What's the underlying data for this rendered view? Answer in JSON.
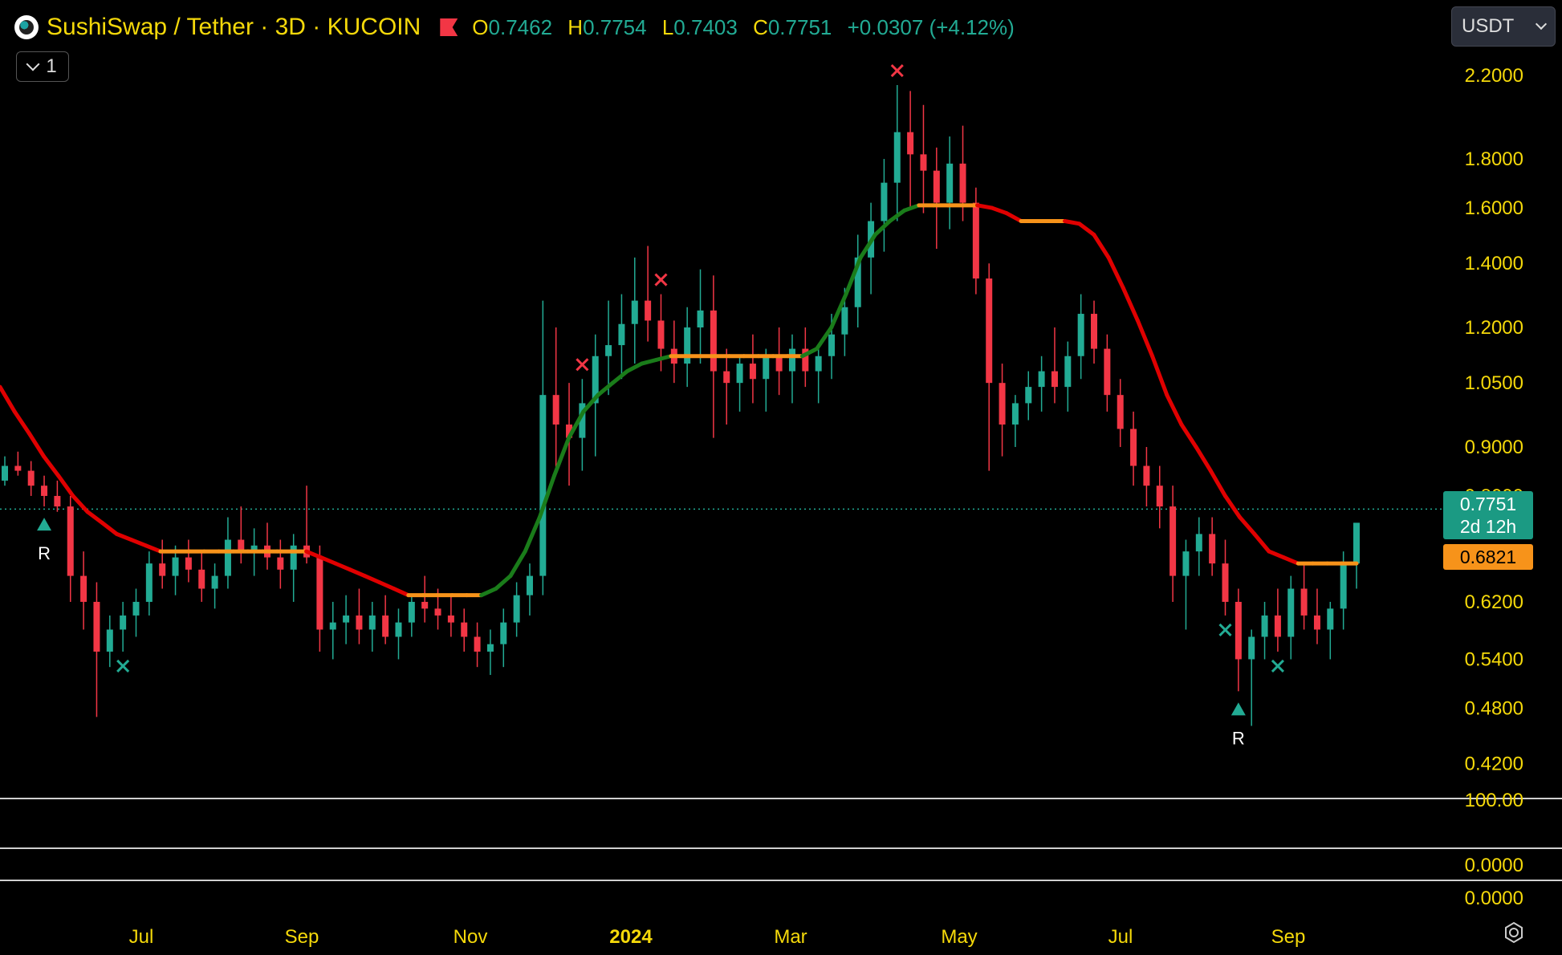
{
  "header": {
    "symbol": "SushiSwap / Tether · 3D · KUCOIN",
    "open_label": "O",
    "open": "0.7462",
    "high_label": "H",
    "high": "0.7754",
    "low_label": "L",
    "low": "0.7403",
    "close_label": "C",
    "close": "0.7751",
    "change": "+0.0307 (+4.12%)"
  },
  "indicator_toggle": {
    "count": "1"
  },
  "currency_select": {
    "value": "USDT"
  },
  "price_tags": {
    "last_price": "0.7751",
    "countdown": "2d 12h",
    "indicator_value": "0.6821"
  },
  "colors": {
    "up": "#22ab94",
    "down": "#f23645",
    "trend_up": "#1a7c1a",
    "trend_down": "#e00000",
    "trend_flat": "#f7931a",
    "axis_text": "#f5d90a"
  },
  "chart_data": {
    "type": "candlestick",
    "y_scale": "log",
    "ylim": [
      0.39,
      2.35
    ],
    "y_ticks": [
      "2.2000",
      "1.8000",
      "1.6000",
      "1.4000",
      "1.2000",
      "1.0500",
      "0.9000",
      "0.8000",
      "0.6200",
      "0.5400",
      "0.4800",
      "0.4200"
    ],
    "x_ticks": [
      "Jul",
      "Sep",
      "Nov",
      "2024",
      "Mar",
      "May",
      "Jul",
      "Sep"
    ],
    "lower_pane_labels": [
      "100.00",
      "0.0000",
      "0.0000"
    ],
    "candles": [
      [
        0.83,
        0.88,
        0.82,
        0.86
      ],
      [
        0.86,
        0.89,
        0.84,
        0.85
      ],
      [
        0.85,
        0.87,
        0.8,
        0.82
      ],
      [
        0.82,
        0.84,
        0.78,
        0.8
      ],
      [
        0.8,
        0.83,
        0.77,
        0.78
      ],
      [
        0.78,
        0.8,
        0.62,
        0.66
      ],
      [
        0.66,
        0.7,
        0.58,
        0.62
      ],
      [
        0.62,
        0.65,
        0.47,
        0.55
      ],
      [
        0.55,
        0.6,
        0.53,
        0.58
      ],
      [
        0.58,
        0.62,
        0.55,
        0.6
      ],
      [
        0.6,
        0.64,
        0.57,
        0.62
      ],
      [
        0.62,
        0.7,
        0.6,
        0.68
      ],
      [
        0.68,
        0.72,
        0.64,
        0.66
      ],
      [
        0.66,
        0.71,
        0.63,
        0.69
      ],
      [
        0.69,
        0.72,
        0.65,
        0.67
      ],
      [
        0.67,
        0.7,
        0.62,
        0.64
      ],
      [
        0.64,
        0.68,
        0.61,
        0.66
      ],
      [
        0.66,
        0.76,
        0.64,
        0.72
      ],
      [
        0.72,
        0.78,
        0.68,
        0.7
      ],
      [
        0.7,
        0.74,
        0.66,
        0.71
      ],
      [
        0.71,
        0.75,
        0.67,
        0.69
      ],
      [
        0.69,
        0.72,
        0.64,
        0.67
      ],
      [
        0.67,
        0.73,
        0.62,
        0.71
      ],
      [
        0.71,
        0.82,
        0.68,
        0.69
      ],
      [
        0.69,
        0.71,
        0.55,
        0.58
      ],
      [
        0.58,
        0.62,
        0.54,
        0.59
      ],
      [
        0.59,
        0.63,
        0.56,
        0.6
      ],
      [
        0.6,
        0.64,
        0.56,
        0.58
      ],
      [
        0.58,
        0.62,
        0.55,
        0.6
      ],
      [
        0.6,
        0.63,
        0.56,
        0.57
      ],
      [
        0.57,
        0.61,
        0.54,
        0.59
      ],
      [
        0.59,
        0.63,
        0.57,
        0.62
      ],
      [
        0.62,
        0.66,
        0.59,
        0.61
      ],
      [
        0.61,
        0.64,
        0.58,
        0.6
      ],
      [
        0.6,
        0.63,
        0.57,
        0.59
      ],
      [
        0.59,
        0.61,
        0.55,
        0.57
      ],
      [
        0.57,
        0.59,
        0.53,
        0.55
      ],
      [
        0.55,
        0.58,
        0.52,
        0.56
      ],
      [
        0.56,
        0.61,
        0.53,
        0.59
      ],
      [
        0.59,
        0.65,
        0.57,
        0.63
      ],
      [
        0.63,
        0.68,
        0.6,
        0.66
      ],
      [
        0.66,
        1.28,
        0.63,
        1.02
      ],
      [
        1.02,
        1.2,
        0.85,
        0.95
      ],
      [
        0.95,
        1.05,
        0.82,
        0.92
      ],
      [
        0.92,
        1.06,
        0.85,
        1.0
      ],
      [
        1.0,
        1.18,
        0.88,
        1.12
      ],
      [
        1.12,
        1.28,
        1.02,
        1.15
      ],
      [
        1.15,
        1.3,
        1.06,
        1.21
      ],
      [
        1.21,
        1.42,
        1.1,
        1.28
      ],
      [
        1.28,
        1.46,
        1.16,
        1.22
      ],
      [
        1.22,
        1.3,
        1.08,
        1.14
      ],
      [
        1.14,
        1.22,
        1.05,
        1.1
      ],
      [
        1.1,
        1.26,
        1.04,
        1.2
      ],
      [
        1.2,
        1.38,
        1.1,
        1.25
      ],
      [
        1.25,
        1.36,
        0.92,
        1.08
      ],
      [
        1.08,
        1.14,
        0.95,
        1.05
      ],
      [
        1.05,
        1.12,
        0.98,
        1.1
      ],
      [
        1.1,
        1.18,
        1.0,
        1.06
      ],
      [
        1.06,
        1.14,
        0.98,
        1.12
      ],
      [
        1.12,
        1.2,
        1.02,
        1.08
      ],
      [
        1.08,
        1.18,
        1.0,
        1.14
      ],
      [
        1.14,
        1.2,
        1.04,
        1.08
      ],
      [
        1.08,
        1.14,
        1.0,
        1.12
      ],
      [
        1.12,
        1.24,
        1.06,
        1.18
      ],
      [
        1.18,
        1.32,
        1.12,
        1.26
      ],
      [
        1.26,
        1.5,
        1.2,
        1.42
      ],
      [
        1.42,
        1.62,
        1.3,
        1.55
      ],
      [
        1.55,
        1.8,
        1.44,
        1.7
      ],
      [
        1.7,
        2.15,
        1.55,
        1.92
      ],
      [
        1.92,
        2.12,
        1.6,
        1.82
      ],
      [
        1.82,
        2.05,
        1.58,
        1.75
      ],
      [
        1.75,
        1.85,
        1.45,
        1.62
      ],
      [
        1.62,
        1.9,
        1.52,
        1.78
      ],
      [
        1.78,
        1.95,
        1.55,
        1.62
      ],
      [
        1.62,
        1.68,
        1.3,
        1.35
      ],
      [
        1.35,
        1.4,
        0.85,
        1.05
      ],
      [
        1.05,
        1.1,
        0.88,
        0.95
      ],
      [
        0.95,
        1.02,
        0.9,
        1.0
      ],
      [
        1.0,
        1.08,
        0.96,
        1.04
      ],
      [
        1.04,
        1.12,
        0.98,
        1.08
      ],
      [
        1.08,
        1.2,
        1.0,
        1.04
      ],
      [
        1.04,
        1.16,
        0.98,
        1.12
      ],
      [
        1.12,
        1.3,
        1.06,
        1.24
      ],
      [
        1.24,
        1.28,
        1.1,
        1.14
      ],
      [
        1.14,
        1.18,
        0.98,
        1.02
      ],
      [
        1.02,
        1.06,
        0.9,
        0.94
      ],
      [
        0.94,
        0.98,
        0.82,
        0.86
      ],
      [
        0.86,
        0.9,
        0.78,
        0.82
      ],
      [
        0.82,
        0.86,
        0.74,
        0.78
      ],
      [
        0.78,
        0.82,
        0.62,
        0.66
      ],
      [
        0.66,
        0.72,
        0.58,
        0.7
      ],
      [
        0.7,
        0.76,
        0.66,
        0.73
      ],
      [
        0.73,
        0.76,
        0.66,
        0.68
      ],
      [
        0.68,
        0.72,
        0.6,
        0.62
      ],
      [
        0.62,
        0.64,
        0.5,
        0.54
      ],
      [
        0.54,
        0.58,
        0.46,
        0.57
      ],
      [
        0.57,
        0.62,
        0.54,
        0.6
      ],
      [
        0.6,
        0.64,
        0.55,
        0.57
      ],
      [
        0.57,
        0.66,
        0.54,
        0.64
      ],
      [
        0.64,
        0.68,
        0.58,
        0.6
      ],
      [
        0.6,
        0.64,
        0.56,
        0.58
      ],
      [
        0.58,
        0.62,
        0.54,
        0.61
      ],
      [
        0.61,
        0.7,
        0.58,
        0.68
      ],
      [
        0.68,
        0.74,
        0.64,
        0.75
      ]
    ],
    "trend_line": [
      1.04,
      0.98,
      0.93,
      0.88,
      0.84,
      0.8,
      0.77,
      0.75,
      0.73,
      0.72,
      0.71,
      0.7,
      0.7,
      0.7,
      0.7,
      0.7,
      0.7,
      0.7,
      0.7,
      0.7,
      0.7,
      0.7,
      0.69,
      0.68,
      0.67,
      0.66,
      0.65,
      0.64,
      0.63,
      0.63,
      0.63,
      0.63,
      0.63,
      0.63,
      0.64,
      0.66,
      0.7,
      0.76,
      0.84,
      0.92,
      0.98,
      1.02,
      1.05,
      1.08,
      1.1,
      1.11,
      1.12,
      1.12,
      1.12,
      1.12,
      1.12,
      1.12,
      1.12,
      1.12,
      1.12,
      1.12,
      1.14,
      1.2,
      1.3,
      1.42,
      1.5,
      1.55,
      1.59,
      1.61,
      1.61,
      1.61,
      1.61,
      1.61,
      1.6,
      1.58,
      1.55,
      1.55,
      1.55,
      1.55,
      1.54,
      1.5,
      1.42,
      1.32,
      1.22,
      1.12,
      1.02,
      0.95,
      0.9,
      0.85,
      0.8,
      0.76,
      0.73,
      0.7,
      0.69,
      0.68,
      0.68,
      0.68,
      0.68,
      0.68
    ],
    "markers": [
      {
        "type": "triangle-up",
        "label": "R",
        "index": 3,
        "color": "#22ab94"
      },
      {
        "type": "cross",
        "index": 9,
        "color": "#22ab94"
      },
      {
        "type": "cross",
        "index": 44,
        "color": "#f23645"
      },
      {
        "type": "cross",
        "index": 50,
        "color": "#f23645"
      },
      {
        "type": "cross",
        "index": 68,
        "color": "#f23645"
      },
      {
        "type": "cross",
        "index": 93,
        "color": "#22ab94"
      },
      {
        "type": "triangle-up",
        "label": "R",
        "index": 94,
        "color": "#22ab94"
      },
      {
        "type": "cross",
        "index": 97,
        "color": "#22ab94"
      }
    ],
    "last_price": 0.7751,
    "indicator_value": 0.6821
  }
}
